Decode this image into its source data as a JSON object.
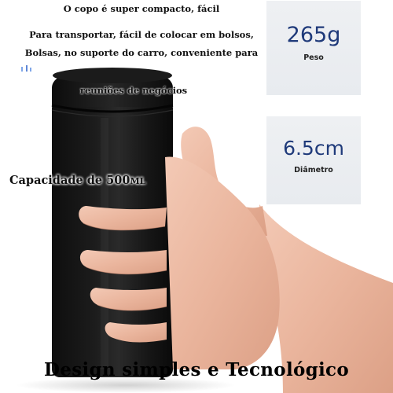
{
  "headline": {
    "line1": "O copo é super compacto, fácil",
    "line2": "Para transportar, fácil de colocar em bolsos,",
    "line3": "Bolsas, no suporte do carro, conveniente para",
    "line4": "reuniões de negócios"
  },
  "capacity": {
    "text": "Capacidade de 500",
    "unit": "ML"
  },
  "specs": {
    "weight": {
      "value": "265g",
      "label": "Peso"
    },
    "diameter": {
      "value": "6.5cm",
      "label": "Diâmetro"
    }
  },
  "footer": {
    "title": "Design simples e Tecnológico"
  },
  "colors": {
    "bottle": "#141414",
    "card_bg": "#eceef2",
    "spec_value": "#1f3a7a"
  },
  "icons": {
    "mark": "small-blue-marks-icon"
  }
}
